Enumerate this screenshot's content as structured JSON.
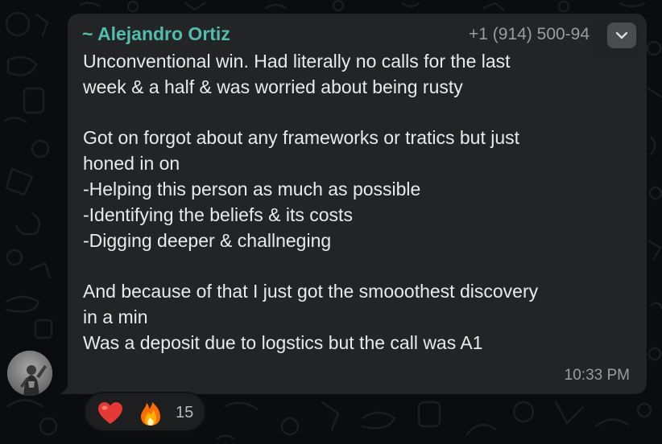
{
  "sender": {
    "name": "~ Alejandro Ortiz",
    "phone": "+1 (914) 500-94"
  },
  "message": {
    "text": "Unconventional win. Had literally no calls for the last\nweek & a half & was worried about being rusty\n\nGot on forgot about any frameworks or tratics but just\nhoned in on\n-Helping this person as much as possible\n-Identifying the beliefs & its costs\n-Digging deeper & challneging\n\nAnd because of that I just got the smooothest discovery\nin a min\nWas a deposit due to logstics but the call was A1",
    "time": "10:33 PM"
  },
  "reactions": {
    "emojis": [
      "heart-icon",
      "fire-icon"
    ],
    "count": "15"
  },
  "colors": {
    "background": "#0b0c0d",
    "bubble": "#222425",
    "sender_name": "#53bdad",
    "text": "#eaeaea",
    "meta_text": "#9a9c9e",
    "heart": "#e53935",
    "fire": "#ff7a1a"
  }
}
